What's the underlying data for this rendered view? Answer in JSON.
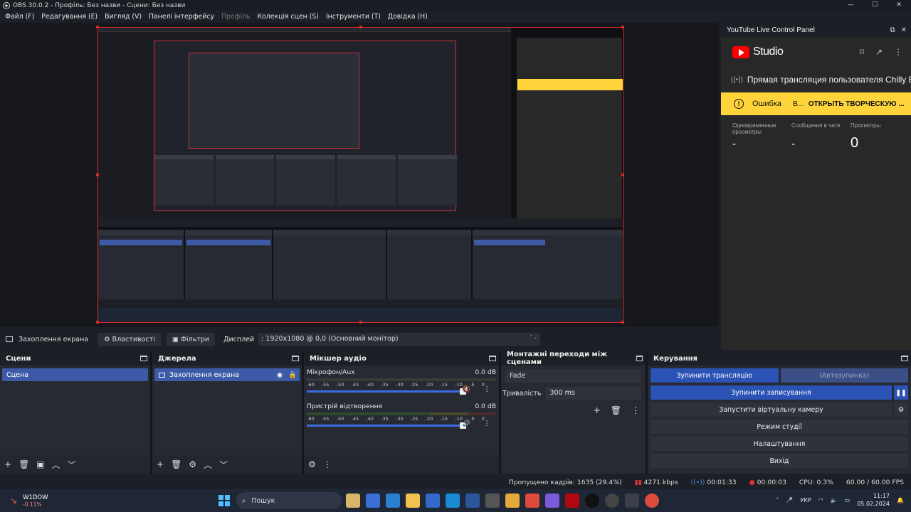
{
  "window": {
    "title": "OBS 30.0.2 - Профіль: Без назви - Сцени: Без назви",
    "min": "—",
    "max": "☐",
    "close": "✕"
  },
  "menu": [
    "Файл (F)",
    "Редагування (E)",
    "Вигляд (V)",
    "Панелі інтерфейсу",
    "Профіль",
    "Колекція сцен (S)",
    "Інструменти (T)",
    "Довідка (H)"
  ],
  "youtube": {
    "panel_title": "YouTube Live Control Panel",
    "studio_label": "Studio",
    "stream_title": "Прямая трансляция пользователя Chilly B...",
    "error_label": "Ошибка",
    "error_short": "В...",
    "error_action": "ОТКРЫТЬ ТВОРЧЕСКУЮ ...",
    "stats": [
      {
        "label": "Одновременные просмотры",
        "value": "-"
      },
      {
        "label": "Сообщения в чате",
        "value": "-"
      },
      {
        "label": "Просмотры",
        "value": "0"
      }
    ]
  },
  "context": {
    "source": "Захоплення екрана",
    "properties": "Властивості",
    "filters": "Фільтри",
    "display_label": "Дисплей",
    "display_value": ": 1920x1080 @ 0,0 (Основний монітор)"
  },
  "docks": {
    "scenes": {
      "title": "Сцени",
      "items": [
        "Сцена"
      ]
    },
    "sources": {
      "title": "Джерела",
      "items": [
        "Захоплення екрана"
      ]
    },
    "mixer": {
      "title": "Мікшер аудіо",
      "channels": [
        {
          "name": "Мікрофон/Aux",
          "db": "0.0 dB",
          "muted": true
        },
        {
          "name": "Пристрій відтворення",
          "db": "0.0 dB",
          "muted": false
        }
      ],
      "ticks": [
        "-60",
        "-55",
        "-50",
        "-45",
        "-40",
        "-35",
        "-30",
        "-25",
        "-20",
        "-15",
        "-10",
        "-5",
        "0"
      ]
    },
    "transitions": {
      "title": "Монтажні переходи між сценами",
      "type": "Fade",
      "duration_label": "Тривалість",
      "duration": "300 ms"
    },
    "controls": {
      "title": "Керування",
      "stop_stream": "Зупинити трансляцію",
      "auto_stop": "(Автозупинка)",
      "stop_record": "Зупинити записування",
      "virtual_cam": "Запустити віртуальну камеру",
      "studio_mode": "Режим студії",
      "settings": "Налаштування",
      "exit": "Вихід"
    }
  },
  "status": {
    "dropped": "Пропущено кадрів: 1635 (29.4%)",
    "bitrate": "4271 kbps",
    "stream_time": "00:01:33",
    "rec_time": "00:00:03",
    "cpu": "CPU: 0.3%",
    "fps": "60.00 / 60.00 FPS"
  },
  "taskbar": {
    "index_name": "W1DOW",
    "index_change": "-0.11%",
    "search": "Пошук",
    "lang": "УКР",
    "time": "11:17",
    "date": "05.02.2024"
  },
  "colors": {
    "accent": "#2b52b5",
    "error_bg": "#ffd43b",
    "yt_red": "#ff0000",
    "rec_red": "#d42a2a"
  }
}
